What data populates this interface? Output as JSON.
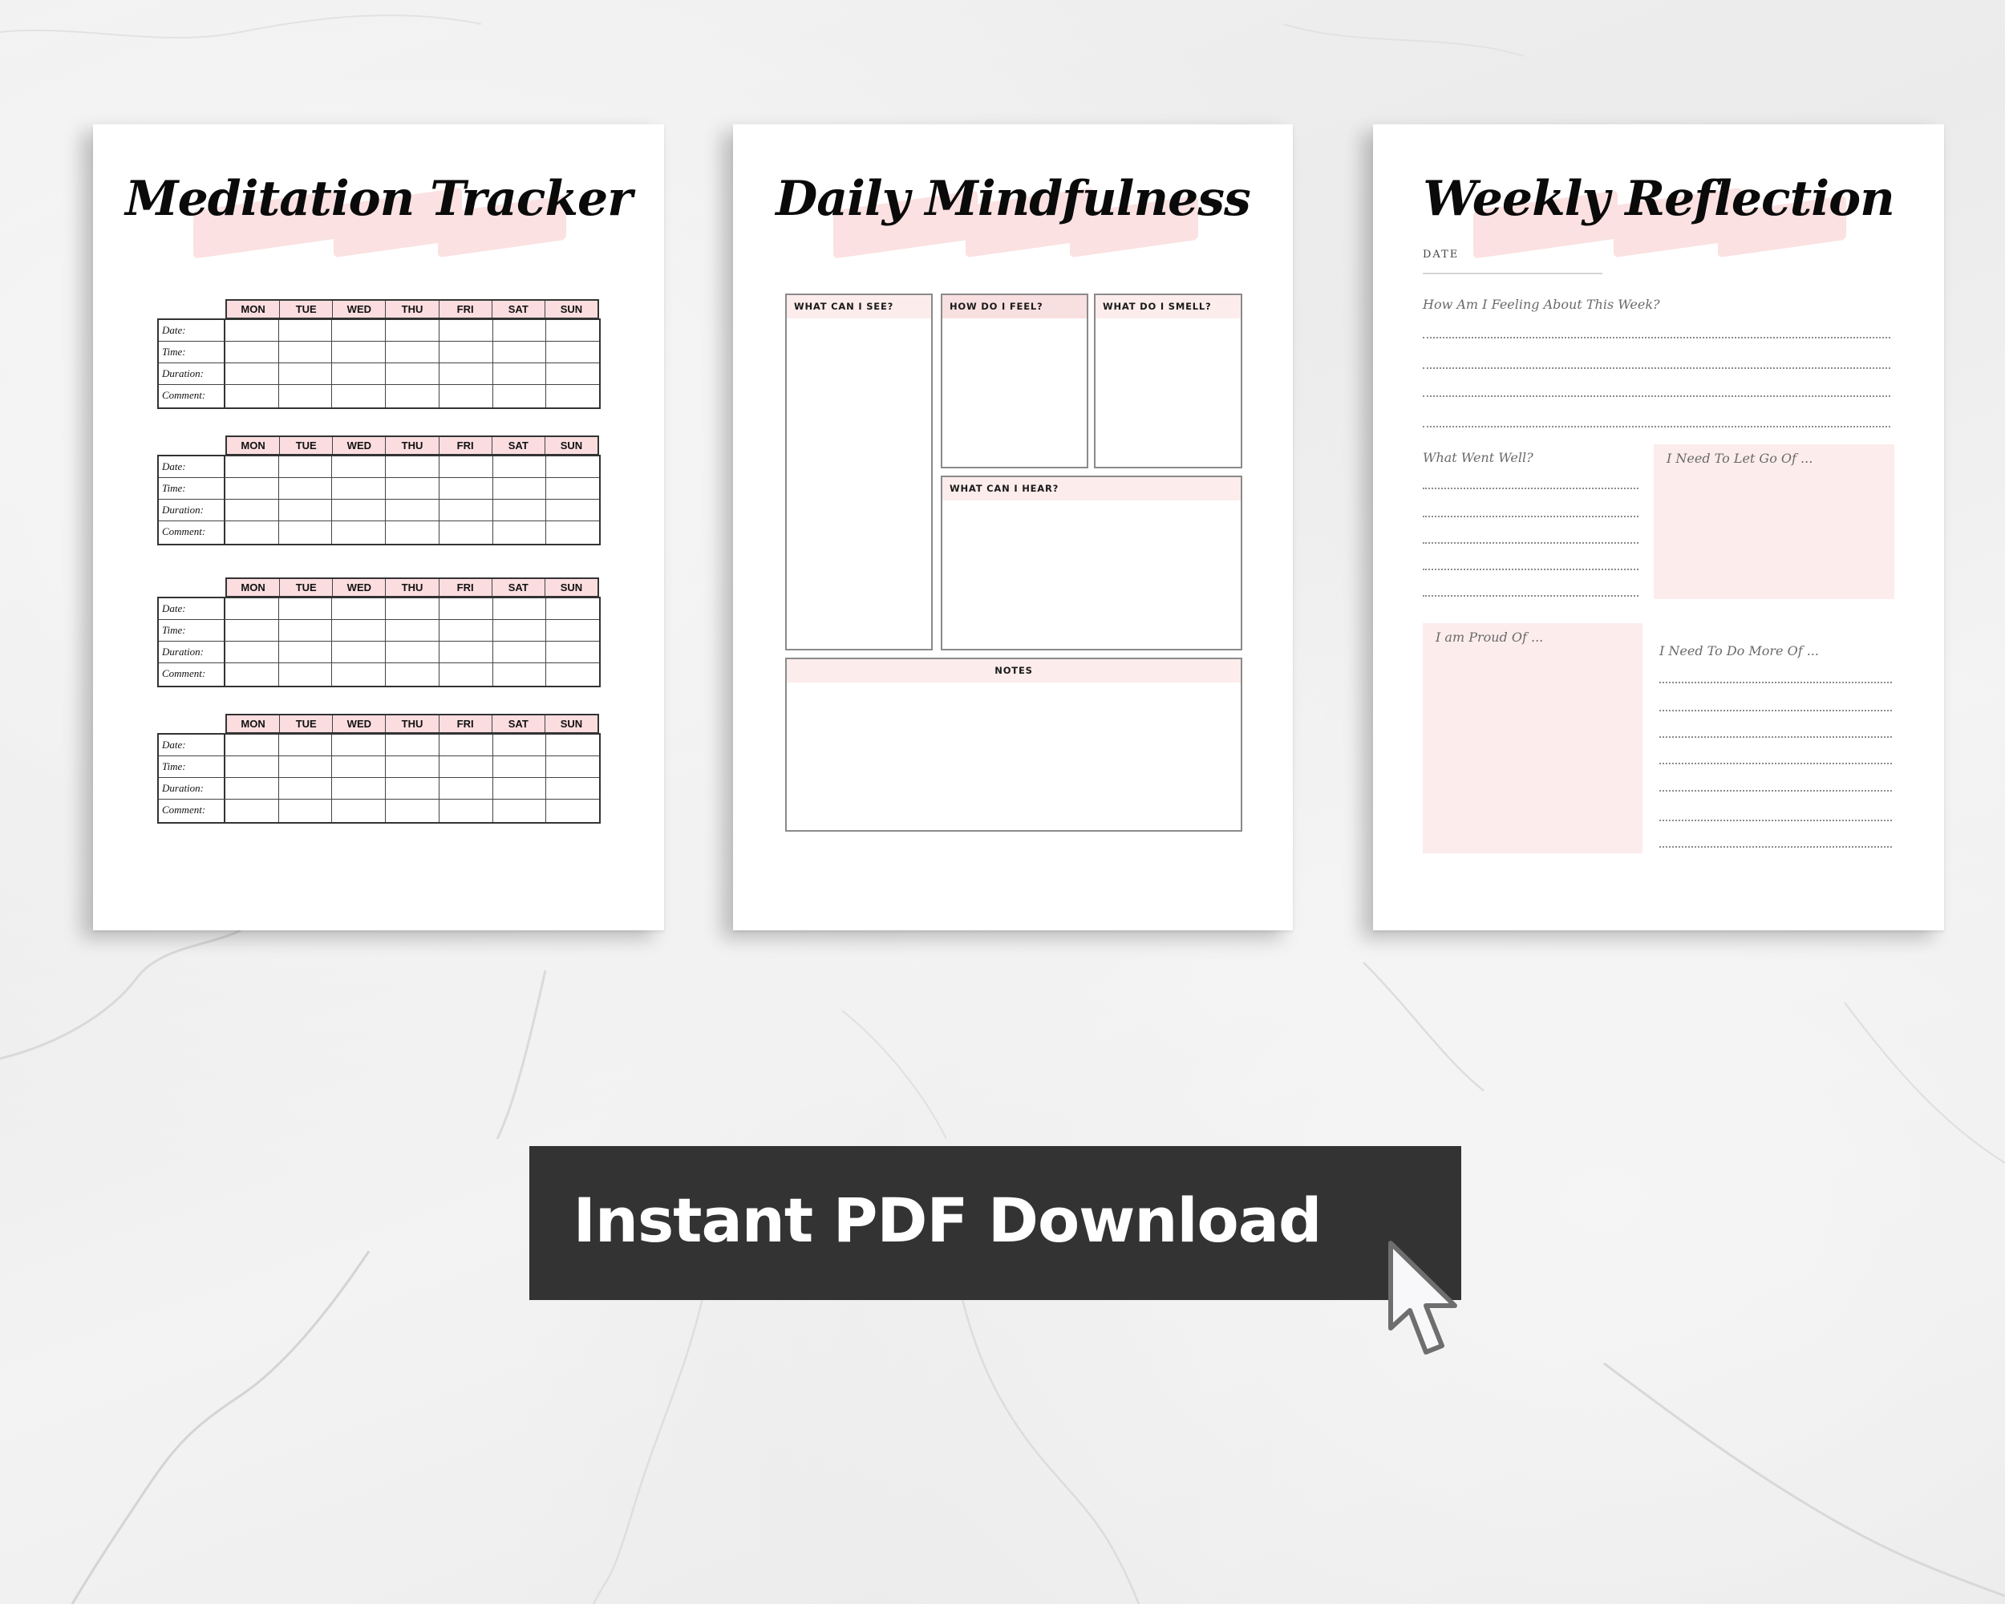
{
  "pages": {
    "meditation_tracker": {
      "title": "Meditation Tracker",
      "days": [
        "MON",
        "TUE",
        "WED",
        "THU",
        "FRI",
        "SAT",
        "SUN"
      ],
      "row_labels": [
        "Date:",
        "Time:",
        "Duration:",
        "Comment:"
      ],
      "table_count": 4
    },
    "daily_mindfulness": {
      "title": "Daily Mindfulness",
      "boxes": {
        "see": "WHAT CAN I SEE?",
        "feel": "HOW DO I FEEL?",
        "smell": "WHAT DO I SMELL?",
        "hear": "WHAT CAN I HEAR?",
        "notes": "NOTES"
      }
    },
    "weekly_reflection": {
      "title": "Weekly Reflection",
      "date_label": "DATE",
      "feeling_prompt": "How Am I Feeling About This Week?",
      "went_well_prompt": "What Went Well?",
      "let_go_prompt": "I Need To Let Go Of ...",
      "proud_prompt": "I am Proud Of ...",
      "do_more_prompt": "I Need To Do More Of ..."
    }
  },
  "cta": {
    "label": "Instant PDF Download"
  },
  "colors": {
    "accent_pink": "#fbdde0",
    "soft_pink": "#fcecec",
    "button_bg": "#333333",
    "button_text": "#ffffff"
  }
}
